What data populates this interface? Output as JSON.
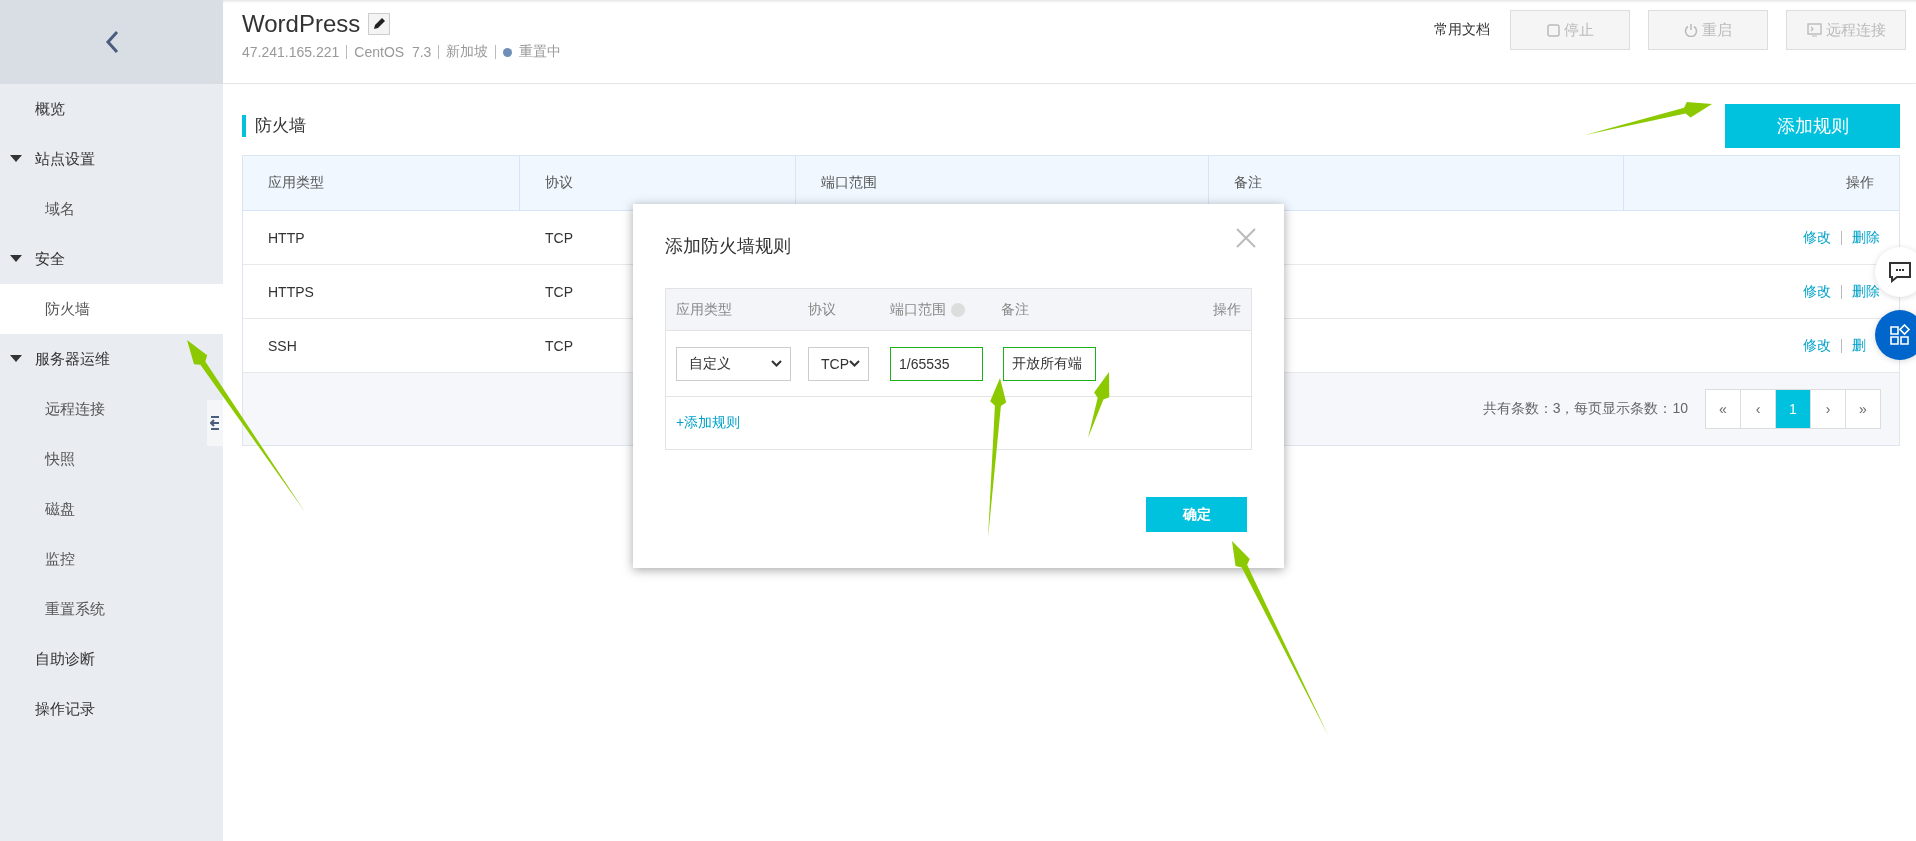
{
  "sidebar": {
    "items": [
      {
        "label": "概览",
        "selected": false
      },
      {
        "label": "站点设置",
        "expanded": true,
        "children": [
          {
            "label": "域名",
            "selected": false
          }
        ]
      },
      {
        "label": "安全",
        "expanded": true,
        "children": [
          {
            "label": "防火墙",
            "selected": true
          }
        ]
      },
      {
        "label": "服务器运维",
        "expanded": true,
        "children": [
          {
            "label": "远程连接",
            "selected": false
          },
          {
            "label": "快照",
            "selected": false
          },
          {
            "label": "磁盘",
            "selected": false
          },
          {
            "label": "监控",
            "selected": false
          },
          {
            "label": "重置系统",
            "selected": false
          }
        ]
      },
      {
        "label": "自助诊断",
        "selected": false
      },
      {
        "label": "操作记录",
        "selected": false
      }
    ]
  },
  "header": {
    "title": "WordPress",
    "meta": [
      "47.241.165.221",
      "CentOS  7.3",
      "新加坡"
    ],
    "status": "重置中",
    "docs_link": "常用文档",
    "buttons": [
      {
        "kind": "stop",
        "label": "停止",
        "disabled": true
      },
      {
        "kind": "restart",
        "label": "重启",
        "disabled": true
      },
      {
        "kind": "remote",
        "label": "远程连接",
        "disabled": true
      }
    ]
  },
  "section": {
    "title": "防火墙",
    "add_button": "添加规则"
  },
  "table": {
    "columns": [
      "应用类型",
      "协议",
      "端口范围",
      "备注",
      "操作"
    ],
    "rows": [
      {
        "cells": [
          "HTTP",
          "TCP"
        ],
        "actions": [
          "修改",
          "删除"
        ]
      },
      {
        "cells": [
          "HTTPS",
          "TCP"
        ],
        "actions": [
          "修改",
          "删除"
        ]
      },
      {
        "cells": [
          "SSH",
          "TCP"
        ],
        "actions": [
          "修改",
          "删"
        ]
      }
    ],
    "summary": "共有条数：3，每页显示条数：10",
    "pages": [
      {
        "label": "«",
        "selected": false
      },
      {
        "label": "‹",
        "selected": false
      },
      {
        "label": "1",
        "selected": true
      },
      {
        "label": "›",
        "selected": false
      },
      {
        "label": "»",
        "selected": false
      }
    ]
  },
  "dialog": {
    "title": "添加防火墙规则",
    "columns": [
      "应用类型",
      "协议",
      "端口范围",
      "备注",
      "操作"
    ],
    "rule": {
      "type": "自定义",
      "protocol": "TCP",
      "port_range": "1/65535",
      "note": "开放所有端"
    },
    "add_link": "+添加规则",
    "confirm": "确定"
  }
}
